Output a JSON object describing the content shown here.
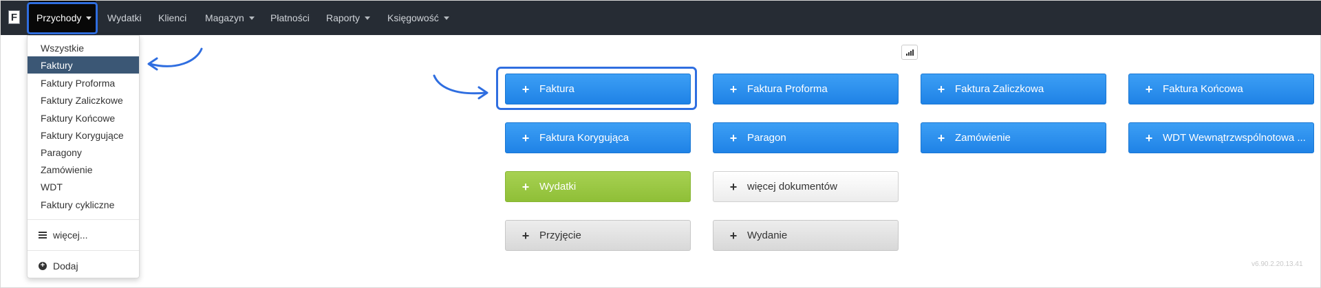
{
  "app": {
    "logo_letter": "F"
  },
  "navbar": {
    "items": [
      {
        "label": "Przychody",
        "caret": true,
        "active": true
      },
      {
        "label": "Wydatki",
        "caret": false
      },
      {
        "label": "Klienci",
        "caret": false
      },
      {
        "label": "Magazyn",
        "caret": true
      },
      {
        "label": "Płatności",
        "caret": false
      },
      {
        "label": "Raporty",
        "caret": true
      },
      {
        "label": "Księgowość",
        "caret": true
      }
    ]
  },
  "dropdown": {
    "items": [
      {
        "label": "Wszystkie"
      },
      {
        "label": "Faktury",
        "selected": true
      },
      {
        "label": "Faktury Proforma"
      },
      {
        "label": "Faktury Zaliczkowe"
      },
      {
        "label": "Faktury Końcowe"
      },
      {
        "label": "Faktury Korygujące"
      },
      {
        "label": "Paragony"
      },
      {
        "label": "Zamówienie"
      },
      {
        "label": "WDT"
      },
      {
        "label": "Faktury cykliczne"
      }
    ],
    "more_label": "więcej...",
    "add_label": "Dodaj"
  },
  "actions": {
    "plus_glyph": "+",
    "buttons": [
      {
        "label": "Faktura",
        "style": "blue"
      },
      {
        "label": "Faktura Proforma",
        "style": "blue"
      },
      {
        "label": "Faktura Zaliczkowa",
        "style": "blue"
      },
      {
        "label": "Faktura Końcowa",
        "style": "blue"
      },
      {
        "label": "Faktura Korygująca",
        "style": "blue"
      },
      {
        "label": "Paragon",
        "style": "blue"
      },
      {
        "label": "Zamówienie",
        "style": "blue"
      },
      {
        "label": "WDT Wewnątrzwspólnotowa ...",
        "style": "blue"
      },
      {
        "label": "Wydatki",
        "style": "green"
      },
      {
        "label": "więcej dokumentów",
        "style": "light"
      },
      {
        "label": "Przyjęcie",
        "style": "gray"
      },
      {
        "label": "Wydanie",
        "style": "gray"
      }
    ]
  },
  "footer": {
    "version": "v6.90.2.20.13.41"
  },
  "colors": {
    "navbar_bg": "#262c34",
    "active_nav_bg": "#080808",
    "selected_item_bg": "#3b5775",
    "primary_blue": "#2a8ef0",
    "success_green": "#9bc944",
    "annotation_blue": "#2f6ee0"
  }
}
